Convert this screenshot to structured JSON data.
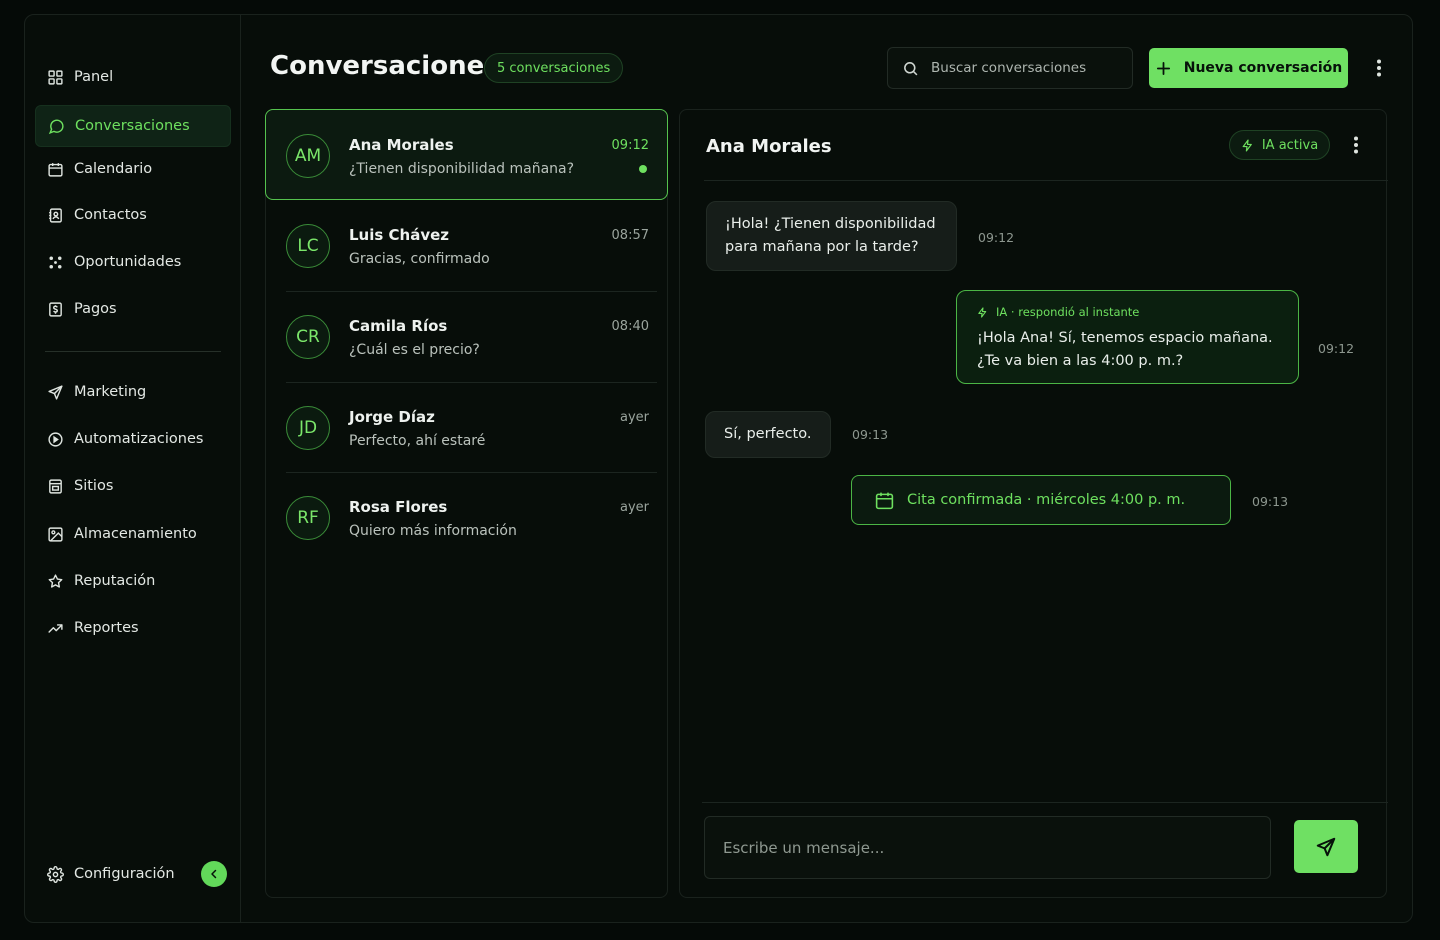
{
  "sidebar": {
    "items": [
      {
        "label": "Panel",
        "icon": "grid-icon"
      },
      {
        "label": "Conversaciones",
        "icon": "chat-bubble-icon"
      },
      {
        "label": "Calendario",
        "icon": "calendar-icon"
      },
      {
        "label": "Contactos",
        "icon": "contacts-icon"
      },
      {
        "label": "Oportunidades",
        "icon": "opportunities-icon"
      },
      {
        "label": "Pagos",
        "icon": "payment-icon"
      },
      {
        "label": "Marketing",
        "icon": "send-icon"
      },
      {
        "label": "Automatizaciones",
        "icon": "automation-icon"
      },
      {
        "label": "Sitios",
        "icon": "site-icon"
      },
      {
        "label": "Almacenamiento",
        "icon": "image-icon"
      },
      {
        "label": "Reputación",
        "icon": "star-icon"
      },
      {
        "label": "Reportes",
        "icon": "trend-icon"
      }
    ],
    "settings_label": "Configuración",
    "active_index": 1
  },
  "header": {
    "title": "Conversaciones",
    "count_badge": "5 conversaciones",
    "search_placeholder": "Buscar conversaciones",
    "new_button": "Nueva conversación"
  },
  "conversations": [
    {
      "initials": "AM",
      "name": "Ana Morales",
      "preview": "¿Tienen disponibilidad mañana?",
      "time": "09:12",
      "unread": true
    },
    {
      "initials": "LC",
      "name": "Luis Chávez",
      "preview": "Gracias, confirmado",
      "time": "08:57",
      "unread": false
    },
    {
      "initials": "CR",
      "name": "Camila Ríos",
      "preview": "¿Cuál es el precio?",
      "time": "08:40",
      "unread": false
    },
    {
      "initials": "JD",
      "name": "Jorge Díaz",
      "preview": "Perfecto, ahí estaré",
      "time": "ayer",
      "unread": false
    },
    {
      "initials": "RF",
      "name": "Rosa Flores",
      "preview": "Quiero más información",
      "time": "ayer",
      "unread": false
    }
  ],
  "chat": {
    "contact_name": "Ana Morales",
    "ai_badge": "IA activa",
    "messages": [
      {
        "direction": "in",
        "line1": "¡Hola! ¿Tienen disponibilidad",
        "line2": "para mañana por la tarde?",
        "time": "09:12"
      },
      {
        "direction": "out",
        "meta": "IA · respondió al instante",
        "line1": "¡Hola Ana! Sí, tenemos espacio mañana.",
        "line2": "¿Te va bien a las 4:00 p. m.?",
        "time": "09:12"
      },
      {
        "direction": "in",
        "line1": "Sí, perfecto.",
        "time": "09:13"
      }
    ],
    "event": {
      "label": "Cita confirmada · miércoles 4:00 p. m.",
      "time": "09:13"
    },
    "composer_placeholder": "Escribe un mensaje..."
  },
  "colors": {
    "accent": "#6fe063",
    "background": "#070d09"
  }
}
